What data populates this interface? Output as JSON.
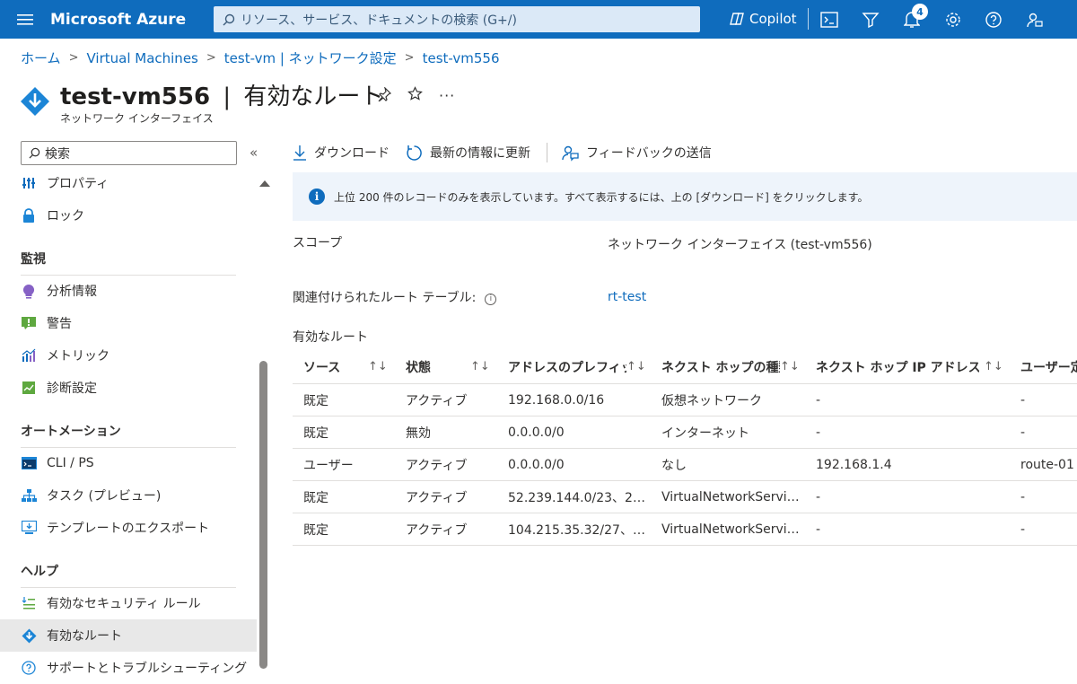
{
  "topbar": {
    "brand": "Microsoft Azure",
    "search_placeholder": "リソース、サービス、ドキュメントの検索 (G+/)",
    "copilot_label": "Copilot",
    "notification_count": "4",
    "bg_color": "#0f6cbd"
  },
  "breadcrumb": {
    "items": [
      "ホーム",
      "Virtual Machines",
      "test-vm | ネットワーク設定",
      "test-vm556"
    ]
  },
  "header": {
    "resource_name": "test-vm556",
    "separator": "|",
    "page_name": "有効なルート",
    "subtitle": "ネットワーク インターフェイス"
  },
  "sidebar": {
    "search_placeholder": "検索",
    "items_top": [
      {
        "label": "プロパティ",
        "icon": "properties-icon"
      },
      {
        "label": "ロック",
        "icon": "lock-icon"
      }
    ],
    "sections": [
      {
        "title": "監視",
        "items": [
          {
            "label": "分析情報",
            "icon": "insights-icon"
          },
          {
            "label": "警告",
            "icon": "alerts-icon"
          },
          {
            "label": "メトリック",
            "icon": "metrics-icon"
          },
          {
            "label": "診断設定",
            "icon": "diagnostic-settings-icon"
          }
        ]
      },
      {
        "title": "オートメーション",
        "items": [
          {
            "label": "CLI / PS",
            "icon": "cli-icon"
          },
          {
            "label": "タスク (プレビュー)",
            "icon": "tasks-icon"
          },
          {
            "label": "テンプレートのエクスポート",
            "icon": "export-template-icon"
          }
        ]
      },
      {
        "title": "ヘルプ",
        "items": [
          {
            "label": "有効なセキュリティ ルール",
            "icon": "security-rules-icon"
          },
          {
            "label": "有効なルート",
            "icon": "routes-icon",
            "active": true
          },
          {
            "label": "サポートとトラブルシューティング",
            "icon": "support-icon"
          }
        ]
      }
    ]
  },
  "toolbar": {
    "download": "ダウンロード",
    "refresh": "最新の情報に更新",
    "feedback": "フィードバックの送信"
  },
  "info": {
    "message": "上位 200 件のレコードのみを表示しています。すべて表示するには、上の [ダウンロード] をクリックします。"
  },
  "fields": {
    "scope_label": "スコープ",
    "scope_value": "ネットワーク インターフェイス (test-vm556)",
    "route_table_label": "関連付けられたルート テーブル:",
    "route_table_value": "rt-test",
    "routes_heading": "有効なルート"
  },
  "table": {
    "columns": [
      "ソース",
      "状態",
      "アドレスのプレフィックス",
      "ネクスト ホップの種類",
      "ネクスト ホップ IP アドレス",
      "ユーザー定"
    ],
    "rows": [
      [
        "既定",
        "アクティブ",
        "192.168.0.0/16",
        "仮想ネットワーク",
        "-",
        "-"
      ],
      [
        "既定",
        "無効",
        "0.0.0.0/0",
        "インターネット",
        "-",
        "-"
      ],
      [
        "ユーザー",
        "アクティブ",
        "0.0.0.0/0",
        "なし",
        "192.168.1.4",
        "route-01"
      ],
      [
        "既定",
        "アクティブ",
        "52.239.144.0/23、2…",
        "VirtualNetworkServi…",
        "-",
        "-"
      ],
      [
        "既定",
        "アクティブ",
        "104.215.35.32/27、…",
        "VirtualNetworkServi…",
        "-",
        "-"
      ]
    ]
  }
}
